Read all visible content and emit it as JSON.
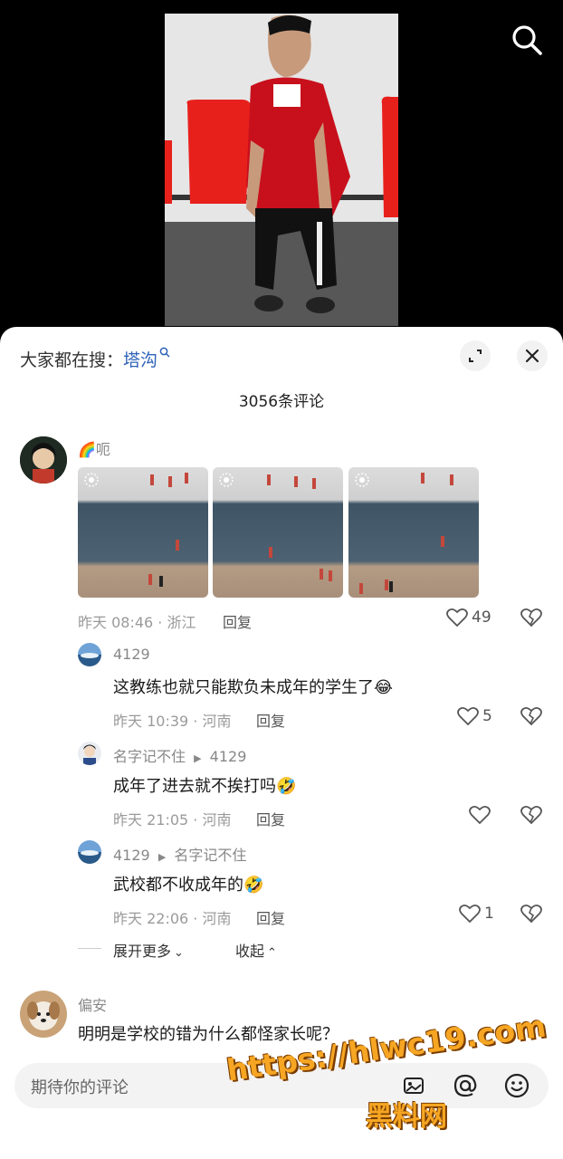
{
  "header": {
    "prefix": "大家都在搜：",
    "keyword": "塔沟"
  },
  "comment_count": "3056条评论",
  "comments": [
    {
      "user": "🌈呃",
      "meta": "昨天 08:46 · 浙江",
      "reply_label": "回复",
      "likes": "49",
      "replies": [
        {
          "user": "4129",
          "text": "这教练也就只能欺负未成年的学生了😂",
          "meta": "昨天 10:39 · 河南",
          "reply_label": "回复",
          "likes": "5"
        },
        {
          "user": "名字记不住",
          "target": "4129",
          "text": "成年了进去就不挨打吗🤣",
          "meta": "昨天 21:05 · 河南",
          "reply_label": "回复",
          "likes": ""
        },
        {
          "user": "4129",
          "target": "名字记不住",
          "text": "武校都不收成年的🤣",
          "meta": "昨天 22:06 · 河南",
          "reply_label": "回复",
          "likes": "1"
        }
      ],
      "expand_more": "展开更多",
      "collapse": "收起"
    },
    {
      "user": "偏安",
      "text": "明明是学校的错为什么都怪家长呢？"
    }
  ],
  "input": {
    "placeholder": "期待你的评论"
  },
  "watermark": {
    "line1": "https://hlwc19.com",
    "line2": "黑料网"
  },
  "colors": {
    "keyword": "#2e62b8",
    "chair": "#e8201c",
    "shirt": "#c8101c",
    "watermark": "#f6a623"
  }
}
